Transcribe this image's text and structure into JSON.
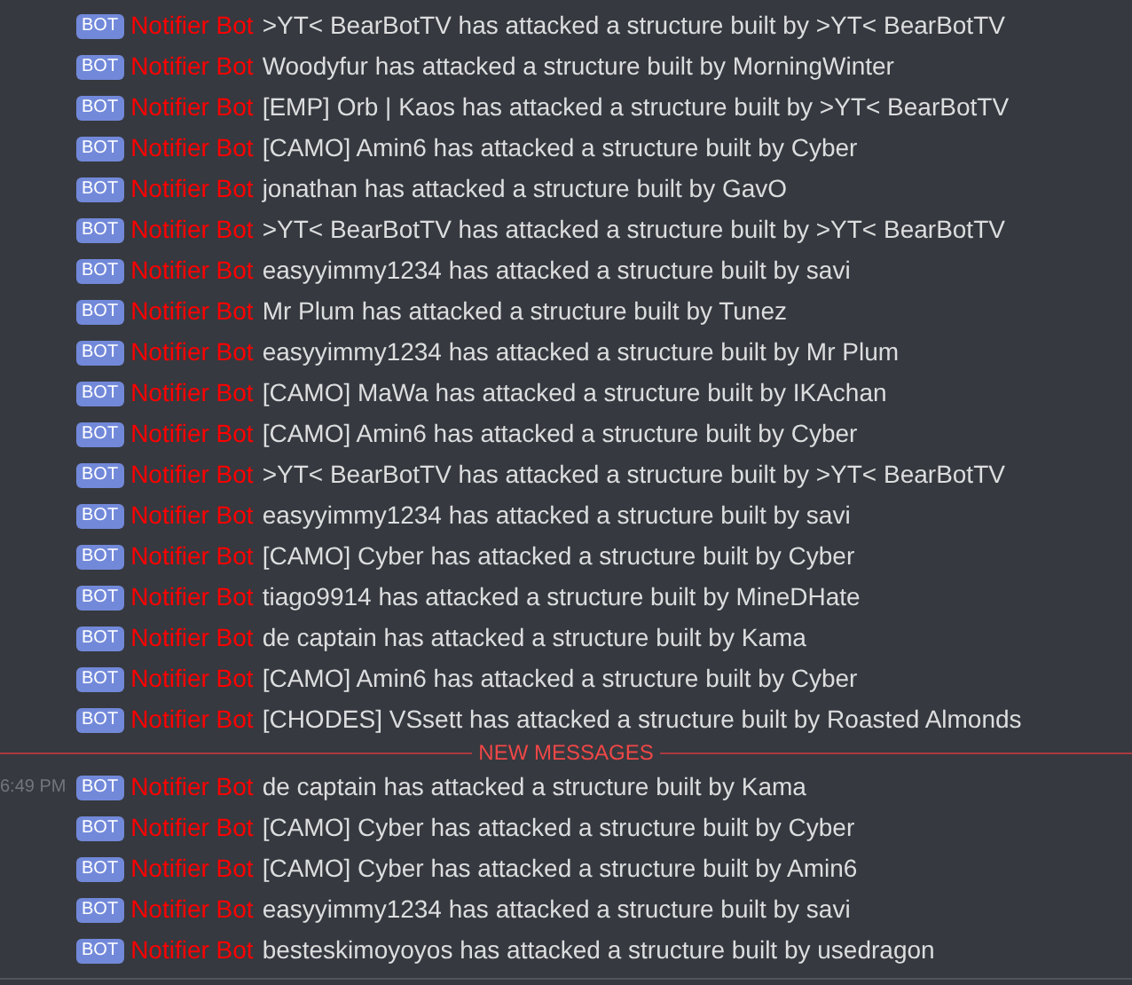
{
  "messages": [
    {
      "kind": "message",
      "badge": "BOT",
      "author": "Notifier Bot",
      "text": ">YT< BearBotTV has attacked a structure built by >YT< BearBotTV"
    },
    {
      "kind": "message",
      "badge": "BOT",
      "author": "Notifier Bot",
      "text": "Woodyfur has attacked a structure built by MorningWinter"
    },
    {
      "kind": "message",
      "badge": "BOT",
      "author": "Notifier Bot",
      "text": "[EMP] Orb | Kaos has attacked a structure built by >YT< BearBotTV"
    },
    {
      "kind": "message",
      "badge": "BOT",
      "author": "Notifier Bot",
      "text": "[CAMO] Amin6 has attacked a structure built by Cyber"
    },
    {
      "kind": "message",
      "badge": "BOT",
      "author": "Notifier Bot",
      "text": "jonathan has attacked a structure built by GavO"
    },
    {
      "kind": "message",
      "badge": "BOT",
      "author": "Notifier Bot",
      "text": ">YT< BearBotTV has attacked a structure built by >YT< BearBotTV"
    },
    {
      "kind": "message",
      "badge": "BOT",
      "author": "Notifier Bot",
      "text": "easyyimmy1234 has attacked a structure built by savi"
    },
    {
      "kind": "message",
      "badge": "BOT",
      "author": "Notifier Bot",
      "text": "Mr Plum has attacked a structure built by Tunez"
    },
    {
      "kind": "message",
      "badge": "BOT",
      "author": "Notifier Bot",
      "text": "easyyimmy1234 has attacked a structure built by Mr Plum"
    },
    {
      "kind": "message",
      "badge": "BOT",
      "author": "Notifier Bot",
      "text": "[CAMO] MaWa has attacked a structure built by IKAchan"
    },
    {
      "kind": "message",
      "badge": "BOT",
      "author": "Notifier Bot",
      "text": "[CAMO] Amin6 has attacked a structure built by Cyber"
    },
    {
      "kind": "message",
      "badge": "BOT",
      "author": "Notifier Bot",
      "text": ">YT< BearBotTV has attacked a structure built by >YT< BearBotTV"
    },
    {
      "kind": "message",
      "badge": "BOT",
      "author": "Notifier Bot",
      "text": "easyyimmy1234 has attacked a structure built by savi"
    },
    {
      "kind": "message",
      "badge": "BOT",
      "author": "Notifier Bot",
      "text": "[CAMO] Cyber has attacked a structure built by Cyber"
    },
    {
      "kind": "message",
      "badge": "BOT",
      "author": "Notifier Bot",
      "text": "tiago9914 has attacked a structure built by MineDHate"
    },
    {
      "kind": "message",
      "badge": "BOT",
      "author": "Notifier Bot",
      "text": "de captain has attacked a structure built by Kama"
    },
    {
      "kind": "message",
      "badge": "BOT",
      "author": "Notifier Bot",
      "text": "[CAMO] Amin6 has attacked a structure built by Cyber"
    },
    {
      "kind": "message",
      "badge": "BOT",
      "author": "Notifier Bot",
      "text": "[CHODES] VSsett has attacked a structure built by Roasted Almonds"
    },
    {
      "kind": "divider",
      "label": "NEW MESSAGES"
    },
    {
      "kind": "message",
      "timestamp": "6:49 PM",
      "badge": "BOT",
      "author": "Notifier Bot",
      "text": "de captain has attacked a structure built by Kama"
    },
    {
      "kind": "message",
      "badge": "BOT",
      "author": "Notifier Bot",
      "text": "[CAMO] Cyber has attacked a structure built by Cyber"
    },
    {
      "kind": "message",
      "badge": "BOT",
      "author": "Notifier Bot",
      "text": "[CAMO] Cyber has attacked a structure built by Amin6"
    },
    {
      "kind": "message",
      "badge": "BOT",
      "author": "Notifier Bot",
      "text": "easyyimmy1234 has attacked a structure built by savi"
    },
    {
      "kind": "message",
      "badge": "BOT",
      "author": "Notifier Bot",
      "text": "besteskimoyoyos has attacked a structure built by usedragon"
    }
  ]
}
